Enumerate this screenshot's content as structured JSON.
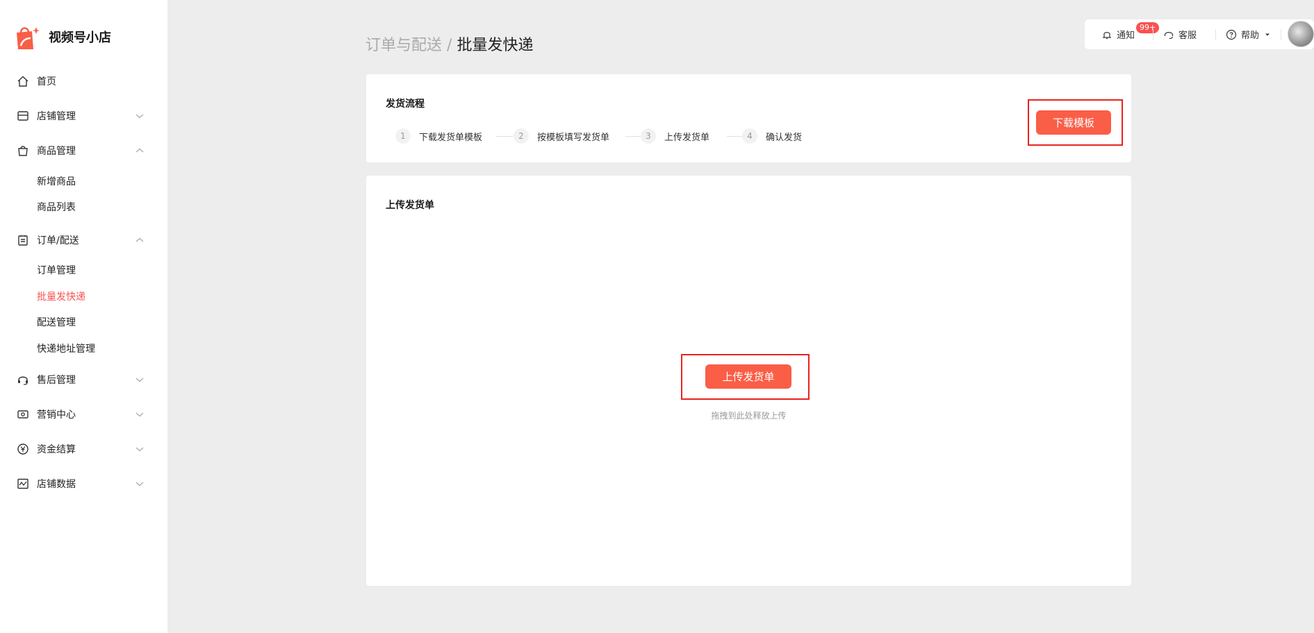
{
  "brand": {
    "name": "视频号小店",
    "color": "#fa5e47"
  },
  "sidebar": {
    "items": [
      {
        "label": "首页",
        "icon": "home-icon"
      },
      {
        "label": "店铺管理",
        "icon": "store-icon",
        "expanded": false
      },
      {
        "label": "商品管理",
        "icon": "bag-icon",
        "expanded": true,
        "children": [
          "新增商品",
          "商品列表"
        ]
      },
      {
        "label": "订单/配送",
        "icon": "clipboard-icon",
        "expanded": true,
        "children": [
          "订单管理",
          "批量发快递",
          "配送管理",
          "快递地址管理"
        ]
      },
      {
        "label": "售后管理",
        "icon": "headset-icon",
        "expanded": false
      },
      {
        "label": "营销中心",
        "icon": "ticket-icon",
        "expanded": false
      },
      {
        "label": "资金结算",
        "icon": "yuan-icon",
        "expanded": false
      },
      {
        "label": "店铺数据",
        "icon": "chart-icon",
        "expanded": false
      }
    ],
    "active_child": "批量发快递",
    "active_color": "#fa5151"
  },
  "breadcrumb": {
    "parent": "订单与配送",
    "separator": "/",
    "current": "批量发快递"
  },
  "topbar": {
    "notify_label": "通知",
    "notify_badge": "99+",
    "service_label": "客服",
    "help_label": "帮助"
  },
  "process_card": {
    "title": "发货流程",
    "steps": [
      {
        "num": "1",
        "label": "下载发货单模板"
      },
      {
        "num": "2",
        "label": "按模板填写发货单"
      },
      {
        "num": "3",
        "label": "上传发货单"
      },
      {
        "num": "4",
        "label": "确认发货"
      }
    ],
    "download_button": "下载模板"
  },
  "upload_card": {
    "title": "上传发货单",
    "upload_button": "上传发货单",
    "drop_hint": "拖拽到此处释放上传"
  }
}
